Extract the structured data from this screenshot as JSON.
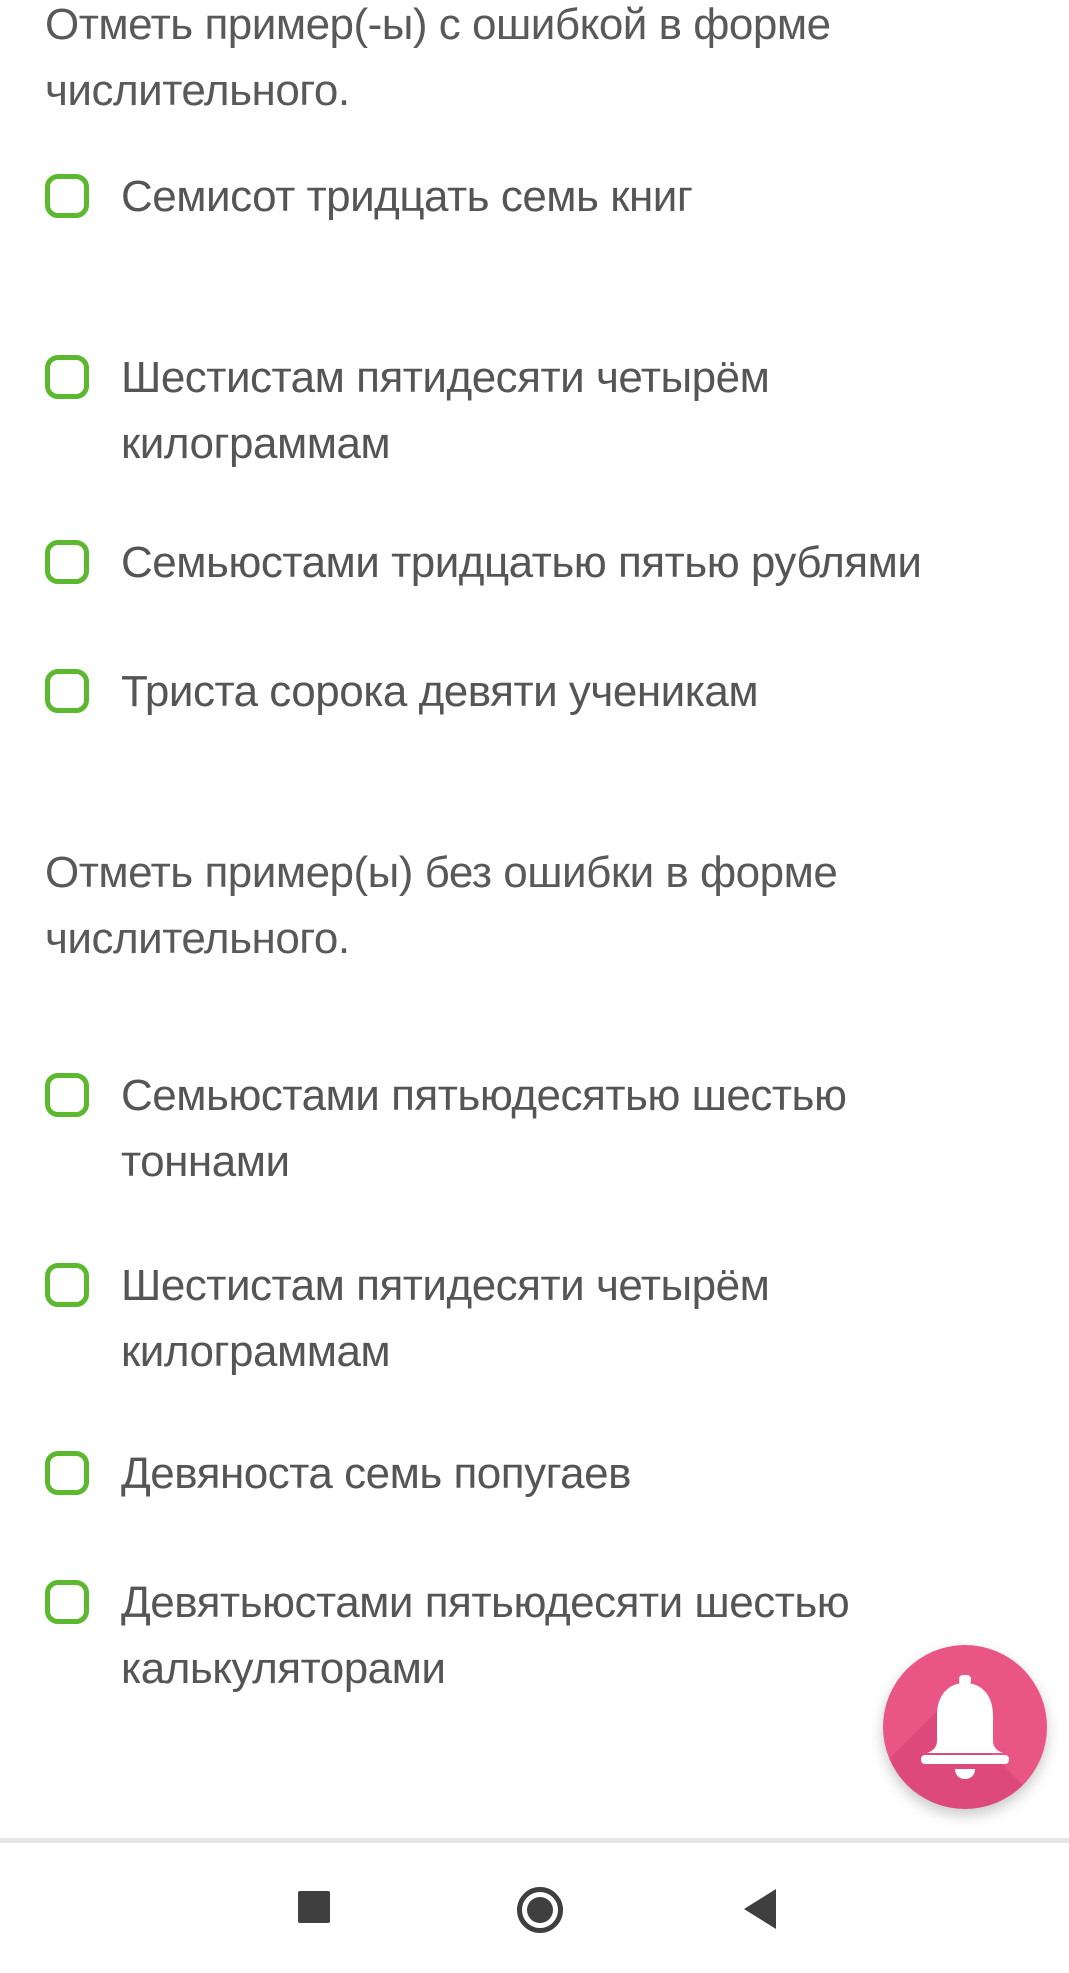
{
  "colors": {
    "checkbox_border": "#5cb82e",
    "text": "#555555",
    "fab_background": "#e95585",
    "nav_icons": "#3f3f3f"
  },
  "questions": [
    {
      "prompt": "Отметь пример(-ы) с ошибкой в форме числительного.",
      "options": [
        {
          "label": "Семисот тридцать семь книг",
          "checked": false
        },
        {
          "label": "Шестистам пятидесяти четырём килограммам",
          "checked": false
        },
        {
          "label": "Семьюстами тридцатью пятью рублями",
          "checked": false
        },
        {
          "label": "Триста сорока девяти ученикам",
          "checked": false
        }
      ]
    },
    {
      "prompt": "Отметь пример(ы) без ошибки в форме числительного.",
      "options": [
        {
          "label": "Семьюстами пятьюдесятью шестью тоннами",
          "checked": false
        },
        {
          "label": "Шестистам пятидесяти четырём килограммам",
          "checked": false
        },
        {
          "label": "Девяноста семь попугаев",
          "checked": false
        },
        {
          "label": "Девятьюстами пятьюдесяти шестью калькуляторами",
          "checked": false
        }
      ]
    }
  ],
  "fab": {
    "icon": "bell-icon"
  },
  "navigation": {
    "recents_icon": "square-icon",
    "home_icon": "circle-icon",
    "back_icon": "triangle-back-icon"
  }
}
